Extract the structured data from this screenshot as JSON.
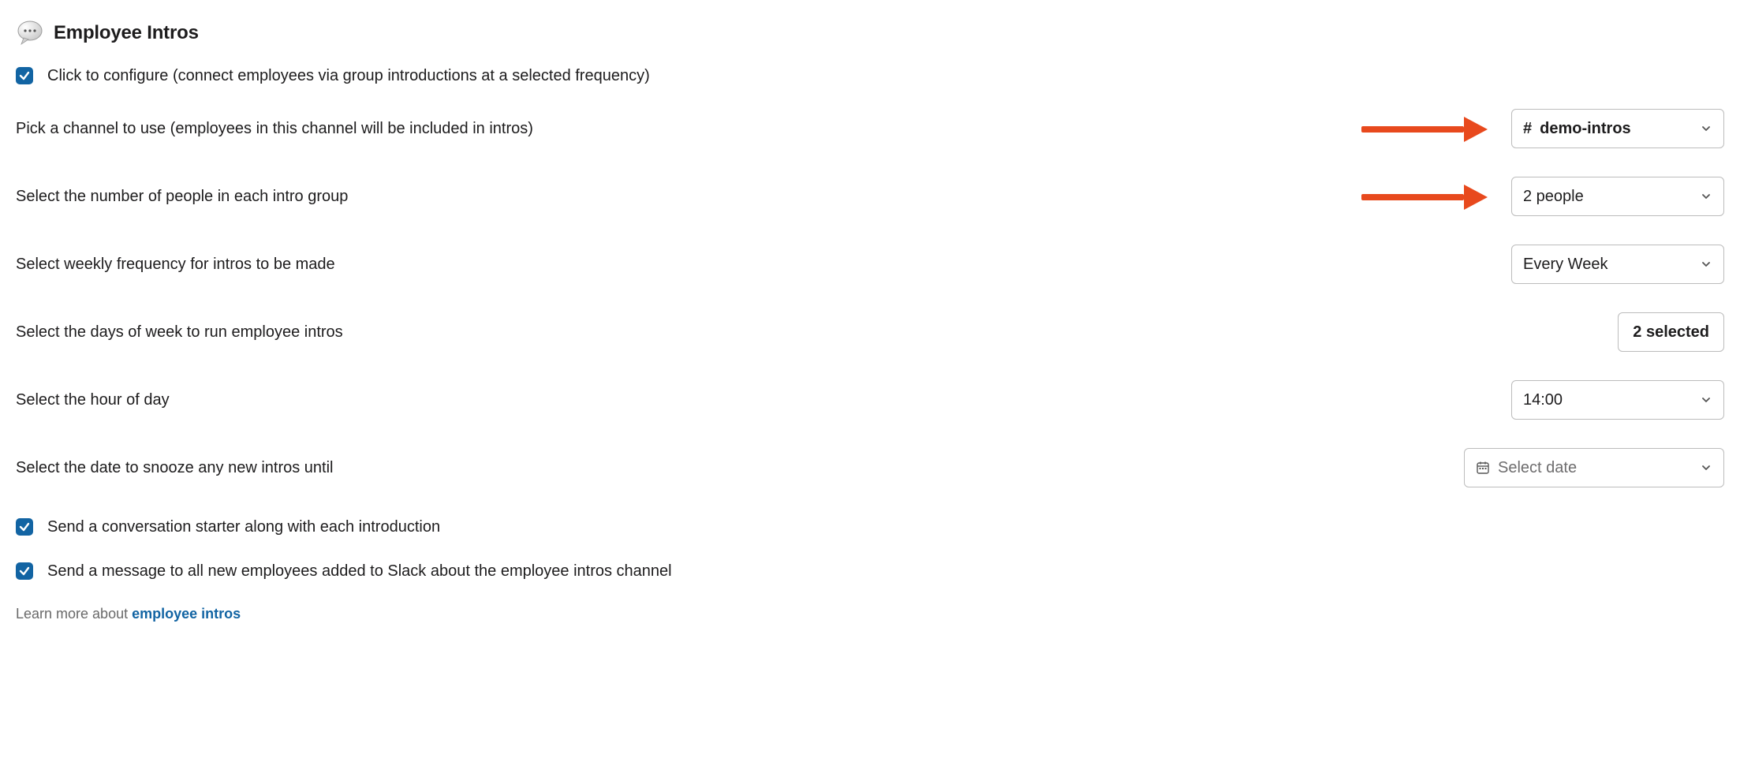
{
  "header": {
    "title": "Employee Intros"
  },
  "configure": {
    "label": "Click to configure (connect employees via group introductions at a selected frequency)"
  },
  "fields": {
    "channel": {
      "label": "Pick a channel to use (employees in this channel will be included in intros)",
      "hash": "#",
      "value": "demo-intros"
    },
    "group_size": {
      "label": "Select the number of people in each intro group",
      "value": "2 people"
    },
    "frequency": {
      "label": "Select weekly frequency for intros to be made",
      "value": "Every Week"
    },
    "days": {
      "label": "Select the days of week to run employee intros",
      "value": "2 selected"
    },
    "hour": {
      "label": "Select the hour of day",
      "value": "14:00"
    },
    "snooze": {
      "label": "Select the date to snooze any new intros until",
      "placeholder": "Select date"
    }
  },
  "options": {
    "conversation_starter": "Send a conversation starter along with each introduction",
    "new_employee_msg": "Send a message to all new employees added to Slack about the employee intros channel"
  },
  "footer": {
    "prefix": "Learn more about ",
    "link": "employee intros"
  }
}
